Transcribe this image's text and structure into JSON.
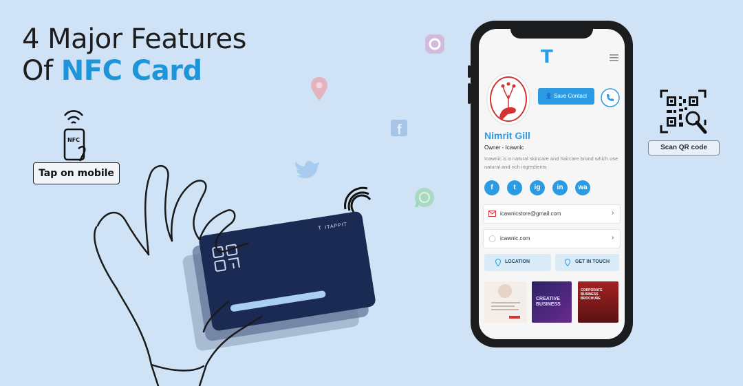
{
  "headline": {
    "line1": "4 Major Features",
    "line2_prefix": "Of",
    "line2_accent": "NFC Card"
  },
  "tap_label": "Tap on mobile",
  "nfc_phone_text": "NFC",
  "scan_label": "Scan QR code",
  "card": {
    "brand": "ITAPPIT"
  },
  "profile": {
    "logo": "T",
    "save_contact": "Save Contact",
    "name": "Nimrit Gill",
    "title": "Owner - Icawnic",
    "bio": "Icawnic is a natural skincare and haircare brand which use natural and rich ingredients",
    "socials": [
      "f",
      "t",
      "ig",
      "in",
      "wa"
    ],
    "email": "icawnicstore@gmail.com",
    "website": "icawnic.com",
    "location_label": "LOCATION",
    "get_in_touch_label": "GET IN TOUCH",
    "thumbs": [
      {
        "title": ""
      },
      {
        "title": "CREATIVE BUSINESS"
      },
      {
        "title": "CORPORATE BUSINESS BROCHURE"
      }
    ]
  },
  "colors": {
    "accent": "#1e95d8",
    "background": "#cfe2f6",
    "card": "#1a2a52"
  }
}
